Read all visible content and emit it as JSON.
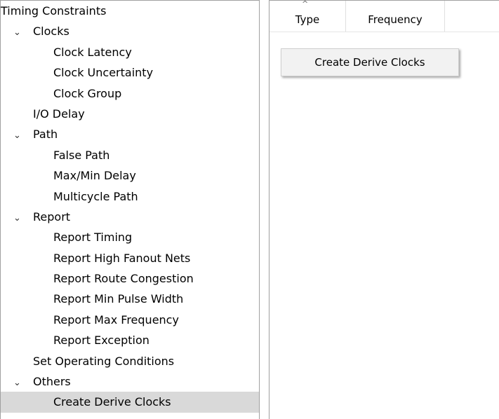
{
  "tree": {
    "root_label": "Timing Constraints",
    "items": [
      {
        "label": "Clocks",
        "expanded": true,
        "children": [
          "Clock Latency",
          "Clock Uncertainty",
          "Clock Group"
        ]
      },
      {
        "label": "I/O Delay"
      },
      {
        "label": "Path",
        "expanded": true,
        "children": [
          "False Path",
          "Max/Min Delay",
          "Multicycle Path"
        ]
      },
      {
        "label": "Report",
        "expanded": true,
        "children": [
          "Report Timing",
          "Report High Fanout Nets",
          "Report Route Congestion",
          "Report Min Pulse Width",
          "Report Max Frequency",
          "Report Exception"
        ]
      },
      {
        "label": "Set Operating Conditions"
      },
      {
        "label": "Others",
        "expanded": true,
        "children": [
          "Create Derive Clocks"
        ]
      }
    ],
    "selected": "Create Derive Clocks"
  },
  "table": {
    "columns": [
      "Type",
      "Frequency"
    ],
    "sort_indicator": "^"
  },
  "context_menu": {
    "create_derive_clocks_label": "Create Derive Clocks"
  },
  "icons": {
    "expand": "chevron-down-icon"
  },
  "colors": {
    "selection": "#d9d9d9",
    "border": "#a0a0a0"
  }
}
